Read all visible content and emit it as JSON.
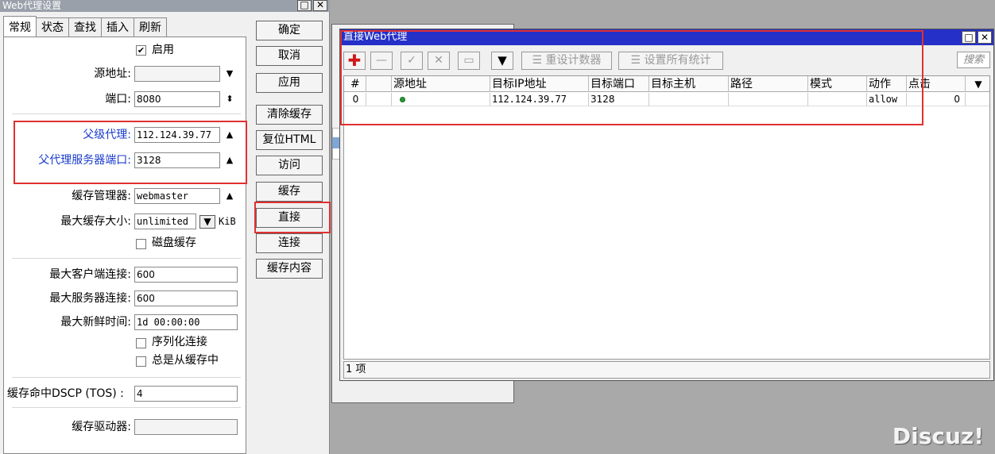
{
  "settings_window": {
    "title": "Web代理设置",
    "tabs": [
      "常规",
      "状态",
      "查找",
      "插入",
      "刷新"
    ],
    "enabled_label": "启用",
    "fields": {
      "src_addr_label": "源地址:",
      "src_addr_value": "",
      "port_label": "端口:",
      "port_value": "8080",
      "parent_proxy_label": "父级代理:",
      "parent_proxy_value": "112.124.39.77",
      "parent_port_label": "父代理服务器端口:",
      "parent_port_value": "3128",
      "cache_admin_label": "缓存管理器:",
      "cache_admin_value": "webmaster",
      "max_cache_label": "最大缓存大小:",
      "max_cache_value": "unlimited",
      "max_cache_unit": "KiB",
      "disk_cache_label": "磁盘缓存",
      "max_client_label": "最大客户端连接:",
      "max_client_value": "600",
      "max_server_label": "最大服务器连接:",
      "max_server_value": "600",
      "max_fresh_label": "最大新鲜时间:",
      "max_fresh_value": "1d 00:00:00",
      "serialize_label": "序列化连接",
      "always_cache_label": "总是从缓存中",
      "dscp_label": "缓存命中DSCP (TOS) :",
      "dscp_value": "4",
      "cache_drive_label": "缓存驱动器:",
      "cache_drive_value": ""
    },
    "buttons": [
      "确定",
      "取消",
      "应用",
      "清除缓存",
      "复位HTML",
      "访问",
      "缓存",
      "直接",
      "连接",
      "缓存内容"
    ]
  },
  "direct_window": {
    "title": "直接Web代理",
    "toolbar": {
      "reset_counters": "重设计数器",
      "reset_all_stats": "设置所有统计",
      "search_placeholder": "搜索"
    },
    "columns": [
      "#",
      "",
      "源地址",
      "目标IP地址",
      "目标端口",
      "目标主机",
      "路径",
      "模式",
      "动作",
      "点击"
    ],
    "rows": [
      {
        "num": "0",
        "src": "",
        "dst_ip": "112.124.39.77",
        "dst_port": "3128",
        "dst_host": "",
        "path": "",
        "mode": "",
        "action": "allow",
        "hits": "0"
      }
    ],
    "status": "1 项"
  },
  "watermark": "Discuz!",
  "colors": {
    "title_active": "#2430c8",
    "highlight_red": "#e03030",
    "label_blue": "#1a3ccc"
  }
}
